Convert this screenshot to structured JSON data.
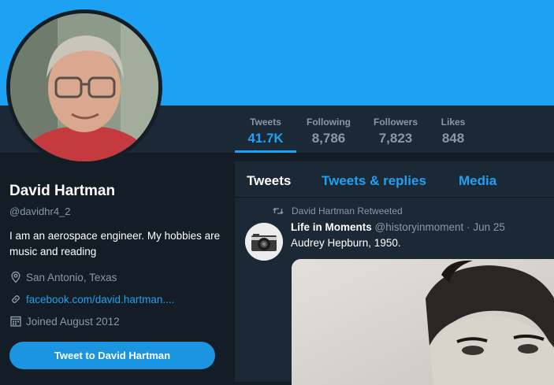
{
  "profile": {
    "name": "David Hartman",
    "handle": "@davidhr4_2",
    "bio": "I am an aerospace engineer. My hobbies are music and reading",
    "location": "San Antonio, Texas",
    "website": "facebook.com/david.hartman....",
    "joined": "Joined August 2012",
    "tweet_to_button": "Tweet to David Hartman"
  },
  "stats": [
    {
      "label": "Tweets",
      "value": "41.7K"
    },
    {
      "label": "Following",
      "value": "8,786"
    },
    {
      "label": "Followers",
      "value": "7,823"
    },
    {
      "label": "Likes",
      "value": "848"
    }
  ],
  "timeline": {
    "tabs": [
      "Tweets",
      "Tweets & replies",
      "Media"
    ],
    "active_tab": "Tweets"
  },
  "tweet": {
    "retweet_label": "David Hartman Retweeted",
    "author": "Life in Moments",
    "handle": "@historyinmoment",
    "separator": "·",
    "date": "Jun 25",
    "text": "Audrey Hepburn, 1950."
  },
  "colors": {
    "accent": "#1da1f2",
    "background": "#141d26",
    "panel": "#1b2836",
    "muted_text": "#8899a6"
  },
  "icons": [
    "location-icon",
    "link-icon",
    "calendar-icon",
    "retweet-icon"
  ]
}
